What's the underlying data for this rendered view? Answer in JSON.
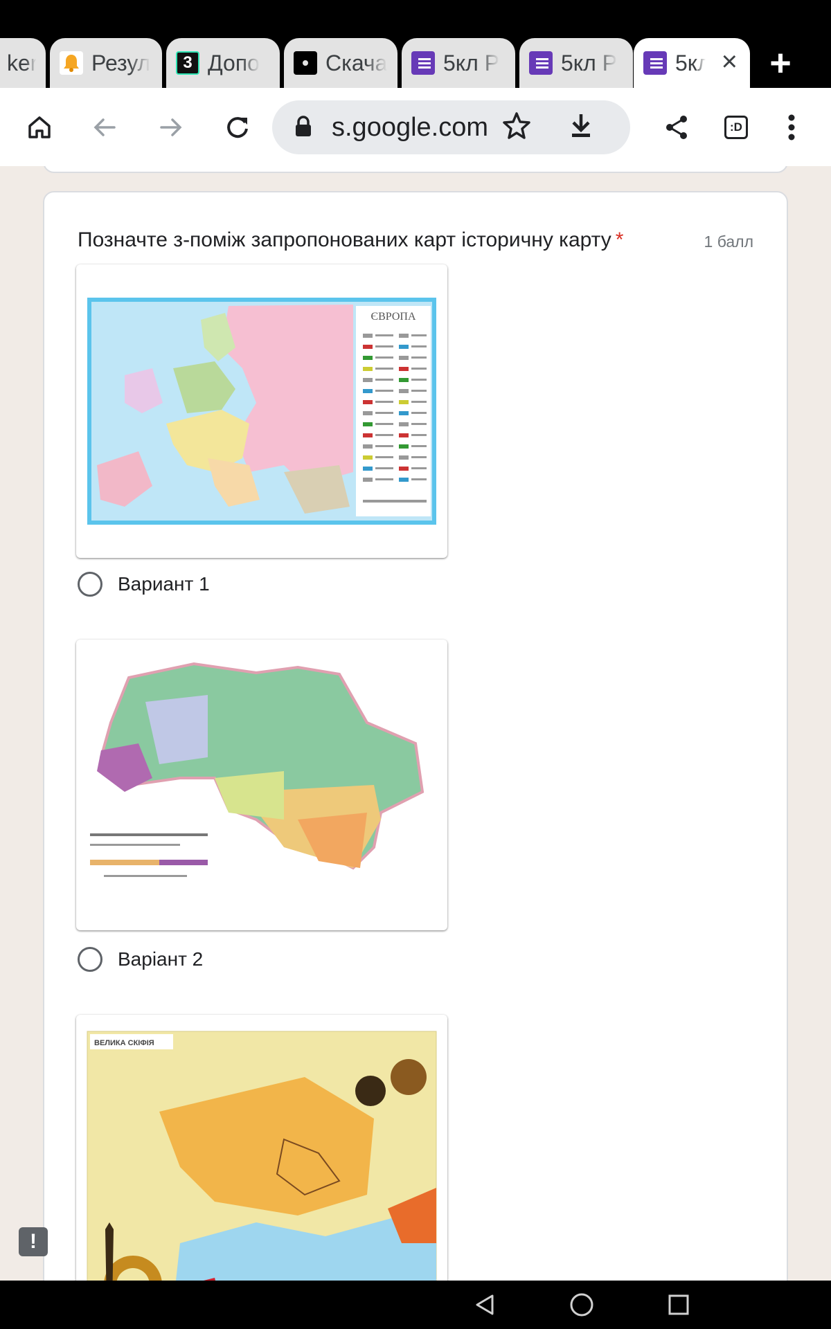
{
  "browser": {
    "tabs": [
      {
        "title": "ker",
        "favicon": "tracker-favicon",
        "active": false
      },
      {
        "title": "Резул",
        "favicon": "bell-favicon",
        "active": false
      },
      {
        "title": "Допо",
        "favicon": "three-favicon",
        "active": false
      },
      {
        "title": "Скача",
        "favicon": "chrome-favicon",
        "active": false
      },
      {
        "title": "5кл Р",
        "favicon": "google-forms-favicon",
        "active": false
      },
      {
        "title": "5кл Р",
        "favicon": "google-forms-favicon",
        "active": false
      },
      {
        "title": "5кл",
        "favicon": "google-forms-favicon",
        "active": true
      }
    ],
    "new_tab_icon": "plus-icon",
    "url": "s.google.com",
    "favicon_three_text": "3",
    "toolbar_icons": [
      "home-icon",
      "back-icon",
      "forward-icon",
      "reload-icon",
      "lock-icon",
      "star-icon",
      "download-icon",
      "share-icon",
      "tab-switcher-icon",
      "more-vert-icon"
    ],
    "tab_switcher_text": ":D"
  },
  "form": {
    "question": "Позначте з-поміж запропонованих карт історичну карту",
    "required_mark": "*",
    "points": "1 балл",
    "options": [
      {
        "label": "Вариант 1",
        "image": "political-map-of-europe",
        "image_title": "ЄВРОПА"
      },
      {
        "label": "Варіант 2",
        "image": "climate-map-of-ukraine"
      },
      {
        "label": "",
        "image": "historical-map-great-scythia",
        "image_title": "ВЕЛИКА СКІФІЯ"
      }
    ],
    "feedback_icon": "!"
  },
  "colors": {
    "forms_purple": "#673ab7",
    "required_red": "#d93025",
    "page_bg": "#f1ebe6"
  },
  "android_nav": [
    "back-triangle-icon",
    "home-circle-icon",
    "recents-square-icon"
  ]
}
